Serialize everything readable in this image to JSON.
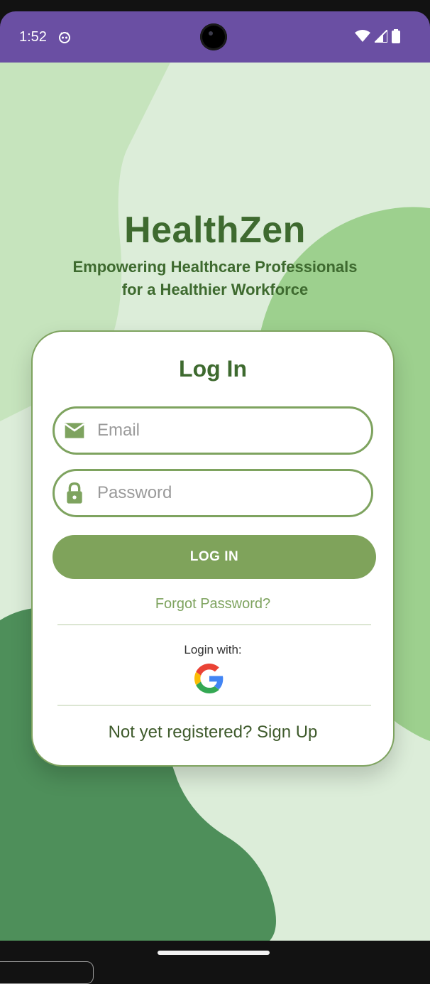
{
  "status_bar": {
    "time": "1:52",
    "app_icon": "robot-face-icon",
    "wifi_icon": "wifi-icon",
    "signal_icon": "cell-signal-icon",
    "battery_icon": "battery-icon"
  },
  "colors": {
    "status_bar": "#6a4fa3",
    "background": "#dcedd9",
    "brand_text": "#3e6a2f",
    "accent": "#7ea35f",
    "button": "#7fa35b"
  },
  "brand": {
    "title": "HealthZen",
    "subtitle_line1": "Empowering Healthcare Professionals",
    "subtitle_line2": "for a Healthier Workforce"
  },
  "login": {
    "title": "Log In",
    "email_placeholder": "Email",
    "email_value": "",
    "email_icon": "mail-icon",
    "password_placeholder": "Password",
    "password_value": "",
    "password_icon": "lock-icon",
    "login_button": "LOG IN",
    "forgot_password": "Forgot Password?",
    "login_with": "Login with:",
    "google_icon": "google-icon",
    "signup_text": "Not yet registered? Sign Up"
  }
}
